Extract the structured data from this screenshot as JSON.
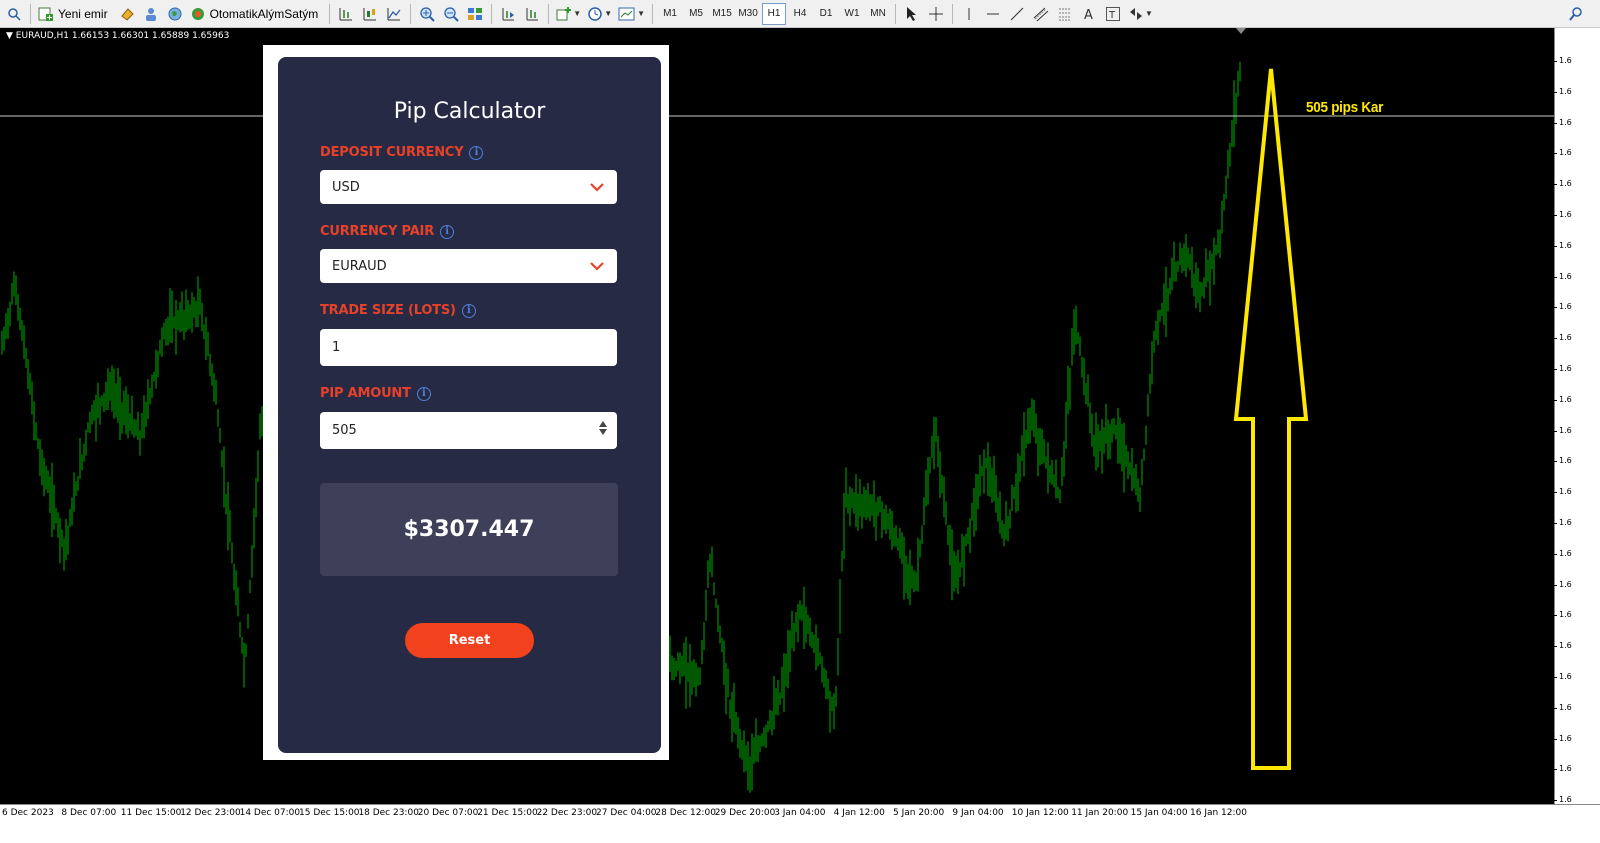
{
  "toolbar": {
    "new_order_label": "Yeni emir",
    "auto_trading_label": "OtomatikAlýmSatým",
    "timeframes": [
      "M1",
      "M5",
      "M15",
      "M30",
      "H1",
      "H4",
      "D1",
      "W1",
      "MN"
    ],
    "active_timeframe": "H1"
  },
  "chart": {
    "symbol_info": "EURAUD,H1  1.66153 1.66301 1.65889 1.65963",
    "annotation": "505 pips Kar",
    "annotation_color": "#ffe800",
    "candle_color": "#00b000",
    "time_labels": [
      "6 Dec 2023",
      "8 Dec 07:00",
      "11 Dec 15:00",
      "12 Dec 23:00",
      "14 Dec 07:00",
      "15 Dec 15:00",
      "18 Dec 23:00",
      "20 Dec 07:00",
      "21 Dec 15:00",
      "22 Dec 23:00",
      "27 Dec 04:00",
      "28 Dec 12:00",
      "29 Dec 20:00",
      "3 Jan 04:00",
      "4 Jan 12:00",
      "5 Jan 20:00",
      "9 Jan 04:00",
      "10 Jan 12:00",
      "11 Jan 20:00",
      "15 Jan 04:00",
      "16 Jan 12:00"
    ],
    "price_labels": [
      "1.6",
      "1.6",
      "1.6",
      "1.6",
      "1.6",
      "1.6",
      "1.6",
      "1.6",
      "1.6",
      "1.6",
      "1.6",
      "1.6",
      "1.6",
      "1.6",
      "1.6",
      "1.6",
      "1.6",
      "1.6",
      "1.6",
      "1.6",
      "1.6",
      "1.6",
      "1.6",
      "1.6",
      "1.6"
    ]
  },
  "calculator": {
    "title": "Pip Calculator",
    "deposit_currency_label": "DEPOSIT CURRENCY",
    "deposit_currency_value": "USD",
    "currency_pair_label": "CURRENCY PAIR",
    "currency_pair_value": "EURAUD",
    "trade_size_label": "TRADE SIZE (LOTS)",
    "trade_size_value": "1",
    "pip_amount_label": "PIP AMOUNT",
    "pip_amount_value": "505",
    "result": "$3307.447",
    "reset_label": "Reset",
    "accent_color": "#e8412a",
    "button_color": "#f2421d",
    "panel_color": "#262a44"
  }
}
